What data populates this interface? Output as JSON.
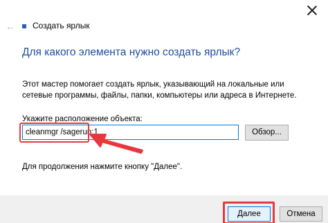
{
  "titlebar": {
    "title": "Создать ярлык",
    "back_icon": "back-arrow-icon",
    "app_icon": "shortcut-wizard-icon",
    "close_icon": "close-icon"
  },
  "wizard": {
    "heading": "Для какого элемента нужно создать ярлык?",
    "description": "Этот мастер помогает создать ярлык, указывающий на локальные или сетевые программы, файлы, папки, компьютеры или адреса в Интернете.",
    "location_label": "Укажите расположение объекта:",
    "location_value": "cleanmgr /sagerun:1",
    "browse_label": "Обзор...",
    "hint": "Для продолжения нажмите кнопку \"Далее\"."
  },
  "footer": {
    "next_label": "Далее",
    "cancel_label": "Отмена"
  },
  "colors": {
    "heading": "#1f4e9c",
    "annotation": "#e8373f",
    "focus_border": "#0078d7"
  }
}
